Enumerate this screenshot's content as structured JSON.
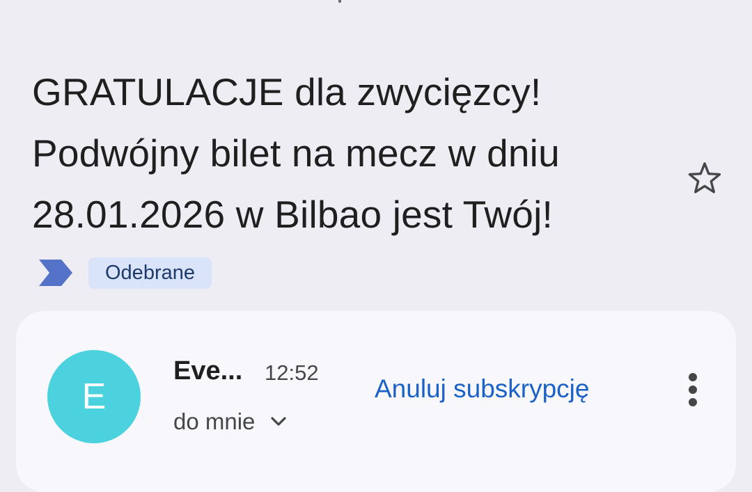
{
  "subject": {
    "lines": [
      "GRATULACJE dla zwycięzcy!",
      "Podwójny bilet na mecz w dniu",
      "28.01.2026 w Bilbao jest Twój!"
    ]
  },
  "label": {
    "text": "Odebrane"
  },
  "message": {
    "avatar_letter": "E",
    "sender": "Eve...",
    "time": "12:52",
    "recipient": "do mnie",
    "unsubscribe_label": "Anuluj subskrypcję"
  },
  "icons": {
    "star": "star-outline-icon",
    "importance": "importance-marker-icon",
    "chevron": "chevron-down-icon",
    "more": "more-vert-icon"
  },
  "colors": {
    "background": "#eeedf3",
    "card": "#f7f7fc",
    "label_chip": "#d9e4fb",
    "importance": "#5472c8",
    "avatar": "#4cd2df",
    "link": "#1b62c8"
  }
}
